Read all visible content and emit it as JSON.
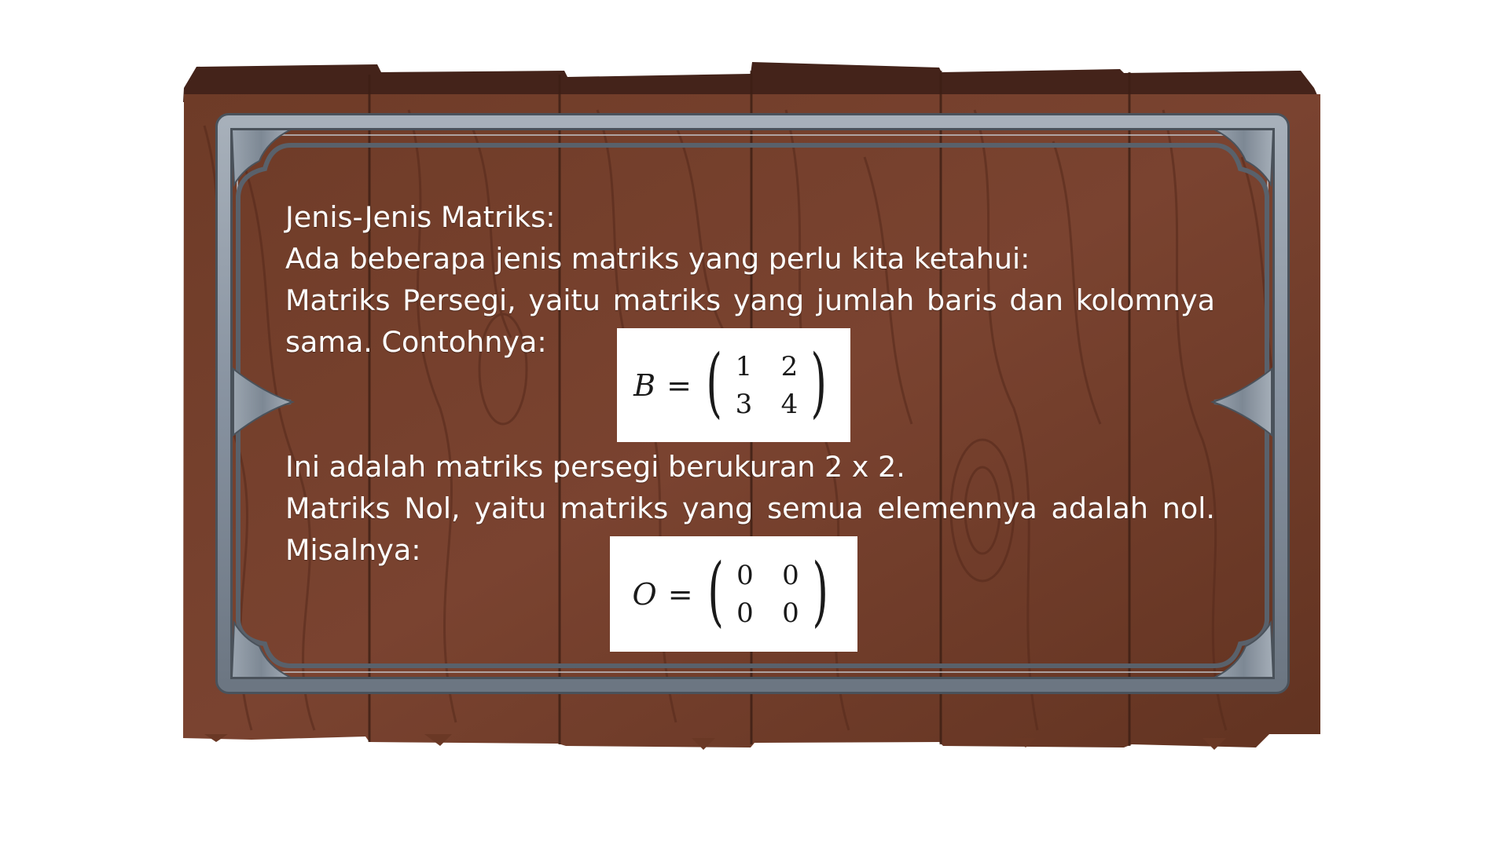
{
  "content": {
    "line1": "Jenis-Jenis Matriks:",
    "line2": "Ada beberapa jenis matriks yang perlu kita ketahui:",
    "para1_a": "Matriks Persegi, yaitu matriks yang jumlah baris dan kolomnya",
    "para1_b": "sama. Contohnya:",
    "line_after_b": "Ini adalah matriks persegi berukuran 2 x 2.",
    "para2_a": "Matriks Nol, yaitu matriks yang semua elemennya adalah nol.",
    "para2_b": "Misalnya:"
  },
  "matrix_b": {
    "name": "B",
    "equals": "=",
    "left_paren": "(",
    "right_paren": ")",
    "cells": [
      "1",
      "2",
      "3",
      "4"
    ]
  },
  "matrix_o": {
    "name": "O",
    "equals": "=",
    "left_paren": "(",
    "right_paren": ")",
    "cells": [
      "0",
      "0",
      "0",
      "0"
    ]
  },
  "colors": {
    "wood_base": "#6b3a26",
    "wood_dark": "#4a2517",
    "wood_light": "#7e4630",
    "frame_steel": "#8c97a3",
    "frame_shadow": "#4b525a",
    "text": "#ffffff",
    "formula_bg": "#ffffff"
  }
}
